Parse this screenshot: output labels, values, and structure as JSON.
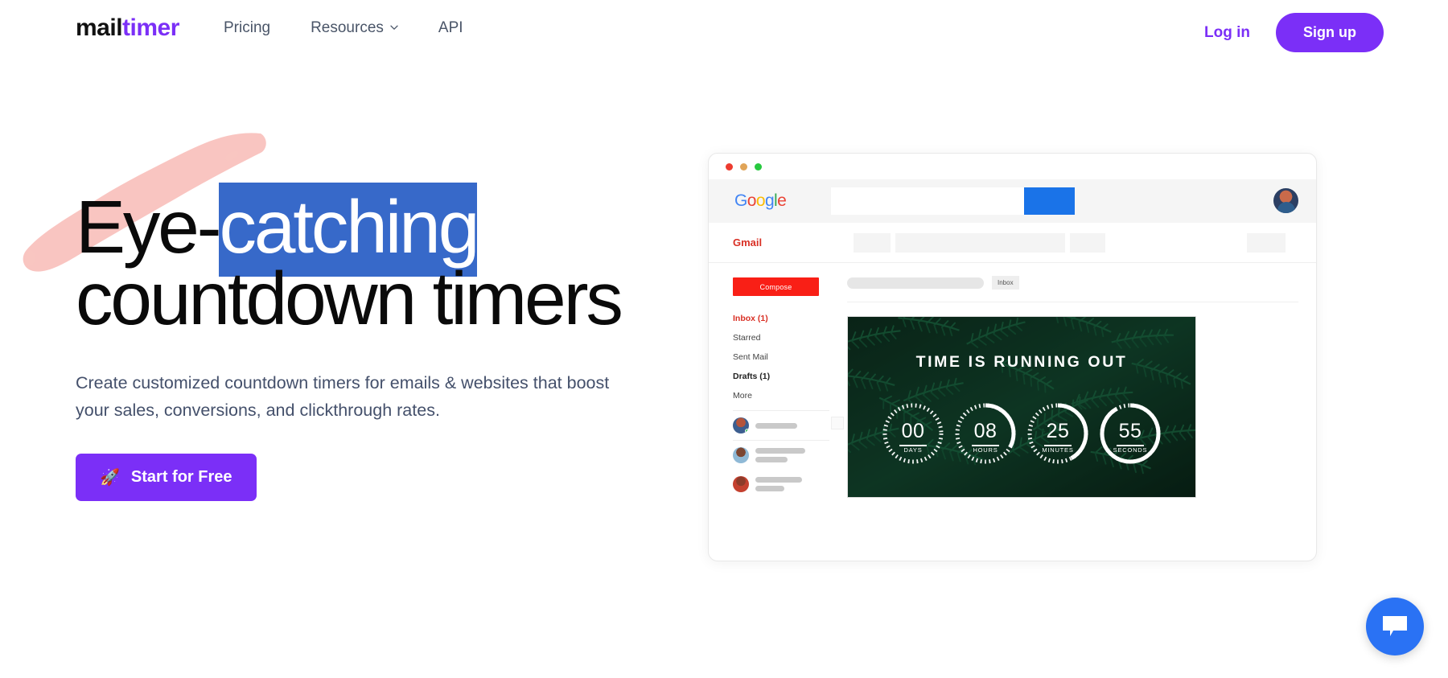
{
  "nav": {
    "logo": {
      "part1": "mail",
      "part2": "timer"
    },
    "links": [
      {
        "label": "Pricing",
        "has_chevron": false,
        "icon": ""
      },
      {
        "label": "Resources",
        "has_chevron": true,
        "icon": "chevron-down-icon"
      },
      {
        "label": "API",
        "has_chevron": false,
        "icon": ""
      }
    ],
    "login_label": "Log in",
    "signup_label": "Sign up"
  },
  "hero": {
    "headline_part1": "Eye-",
    "headline_selected": "catching",
    "headline_part2": "countdown timers",
    "subhead": "Create customized countdown timers for emails & websites that boost your sales, conversions, and clickthrough rates.",
    "cta_label": "Start for Free",
    "cta_icon": "rocket-icon",
    "cta_glyph": "🚀"
  },
  "mock": {
    "window_dots": [
      "red",
      "yellow",
      "green"
    ],
    "google_logo": [
      "G",
      "o",
      "o",
      "g",
      "l",
      "e"
    ],
    "gmail_label": "Gmail",
    "compose_label": "Compose",
    "sidebar_items": [
      {
        "label": "Inbox (1)",
        "style": "active"
      },
      {
        "label": "Starred",
        "style": "normal"
      },
      {
        "label": "Sent Mail",
        "style": "normal"
      },
      {
        "label": "Drafts (1)",
        "style": "bold"
      },
      {
        "label": "More",
        "style": "normal"
      }
    ],
    "inbox_tag": "Inbox"
  },
  "banner": {
    "title": "TIME IS RUNNING OUT",
    "units": [
      {
        "value": "00",
        "label": "DAYS",
        "progress": 0.0
      },
      {
        "value": "08",
        "label": "HOURS",
        "progress": 0.33
      },
      {
        "value": "25",
        "label": "MINUTES",
        "progress": 0.42
      },
      {
        "value": "55",
        "label": "SECONDS",
        "progress": 0.92
      }
    ]
  },
  "chat": {
    "icon": "chat-bubble-icon"
  },
  "colors": {
    "brand_purple": "#7b2ff7",
    "selection_blue": "#3769c9",
    "brush_pink": "#f9c5c1",
    "nav_text": "#4a5568",
    "gmail_red": "#d93025",
    "compose_red": "#f91f16",
    "chat_blue": "#2a72f4",
    "banner_green": "#0e2a1d"
  }
}
